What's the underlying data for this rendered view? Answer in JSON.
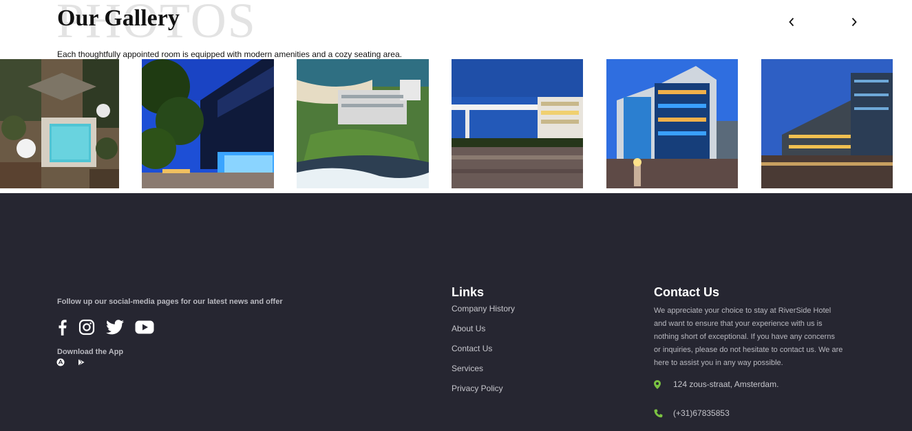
{
  "gallery": {
    "watermark": "PHOTOS",
    "title": "Our Gallery",
    "subtitle": "Each thoughtfully appointed room is equipped with modern amenities and a cozy seating area.",
    "nav": {
      "prev_icon": "chevron-left-icon",
      "next_icon": "chevron-right-icon"
    },
    "images": [
      {
        "name": "resort-pool-aerial"
      },
      {
        "name": "glass-office-tower"
      },
      {
        "name": "coastal-resort-aerial"
      },
      {
        "name": "modern-plaza-dusk"
      },
      {
        "name": "glass-apartment-building"
      },
      {
        "name": "glass-office-block"
      }
    ]
  },
  "footer": {
    "follow_text": "Follow up our social-media pages for our latest news and offer",
    "social_icons": [
      "facebook-icon",
      "instagram-icon",
      "twitter-icon",
      "youtube-icon"
    ],
    "download_label": "Download the App",
    "store_icons": [
      "app-store-icon",
      "google-play-icon"
    ],
    "links": {
      "title": "Links",
      "items": [
        "Company History",
        "About Us",
        "Contact Us",
        "Services",
        "Privacy Policy"
      ]
    },
    "contact": {
      "title": "Contact Us",
      "text": "We appreciate your choice to stay at RiverSide Hotel and want to ensure that your experience with us is nothing short of exceptional. If you have any concerns or inquiries, please do not hesitate to contact us. We are here to assist you in any way possible.",
      "address": "124 zous-straat, Amsterdam.",
      "phone": "(+31)67835853",
      "accent_color": "#7bc242"
    }
  },
  "colors": {
    "footer_bg": "#262631",
    "watermark": "#e3e3e3"
  }
}
